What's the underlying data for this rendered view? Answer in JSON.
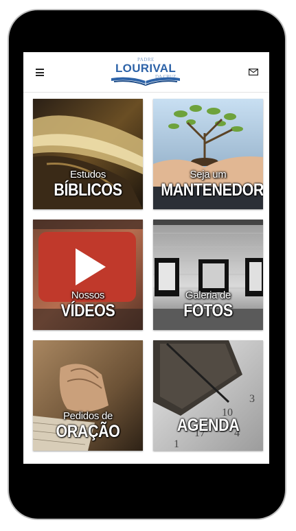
{
  "brand": {
    "prefix": "PADRE",
    "name": "LOURIVAL",
    "suffix": "DA CRUZ"
  },
  "header": {
    "menu_icon": "hamburger-icon",
    "mail_icon": "envelope-icon"
  },
  "tiles": [
    {
      "small": "Estudos",
      "big": "BÍBLICOS"
    },
    {
      "small": "Seja um",
      "big": "MANTENEDOR"
    },
    {
      "small": "Nossos",
      "big": "VÍDEOS"
    },
    {
      "small": "Galeria de",
      "big": "FOTOS"
    },
    {
      "small": "Pedidos de",
      "big": "ORAÇÃO"
    },
    {
      "small": "",
      "big": "AGENDA"
    }
  ]
}
